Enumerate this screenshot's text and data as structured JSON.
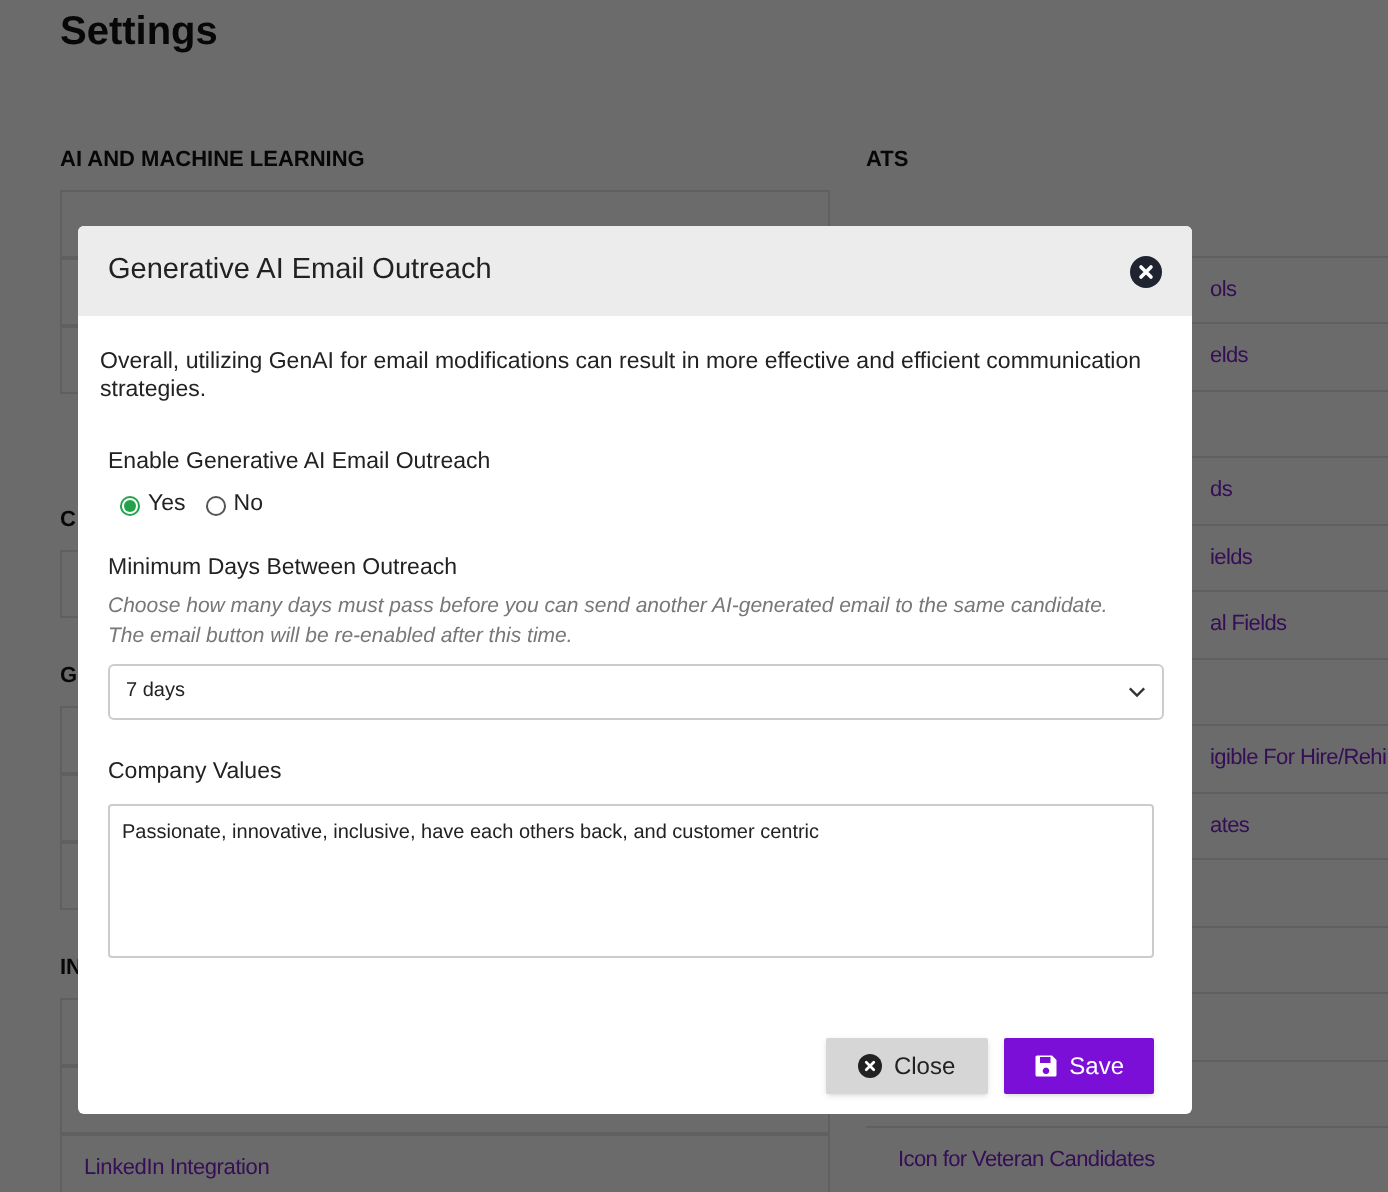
{
  "page": {
    "title": "Settings",
    "left_sections": [
      {
        "heading": "AI AND MACHINE LEARNING"
      },
      {
        "heading": "C"
      },
      {
        "heading": "G"
      },
      {
        "heading": "IN",
        "items": [
          "LinkedIn Integration"
        ]
      }
    ],
    "right_section": {
      "heading": "ATS",
      "items": [
        {
          "label": "ols",
          "kind": "partial"
        },
        {
          "label": "elds",
          "kind": "partial"
        },
        {
          "label": "ds",
          "kind": "partial"
        },
        {
          "label": "ields",
          "kind": "partial"
        },
        {
          "label": "al Fields",
          "kind": "partial"
        },
        {
          "label": "igible For Hire/Rehi",
          "kind": "partial"
        },
        {
          "label": "ates",
          "kind": "partial"
        },
        {
          "label": "Icon for Veteran Candidates",
          "kind": "link"
        }
      ]
    }
  },
  "modal": {
    "title": "Generative AI Email Outreach",
    "paragraph": "Overall, utilizing GenAI for email modifications can result in more effective and efficient communication strategies.",
    "enable": {
      "label": "Enable Generative AI Email Outreach",
      "options": [
        {
          "label": "Yes",
          "selected": true
        },
        {
          "label": "No",
          "selected": false
        }
      ]
    },
    "min_days": {
      "label": "Minimum Days Between Outreach",
      "help": "Choose how many days must pass before you can send another AI-generated email to the same candidate. The email button will be re-enabled after this time.",
      "value": "7 days"
    },
    "company_values": {
      "label": "Company Values",
      "value": "Passionate, innovative, inclusive, have each others back, and customer centric"
    },
    "buttons": [
      {
        "label": "Close",
        "kind": "close"
      },
      {
        "label": "Save",
        "kind": "save"
      }
    ]
  }
}
